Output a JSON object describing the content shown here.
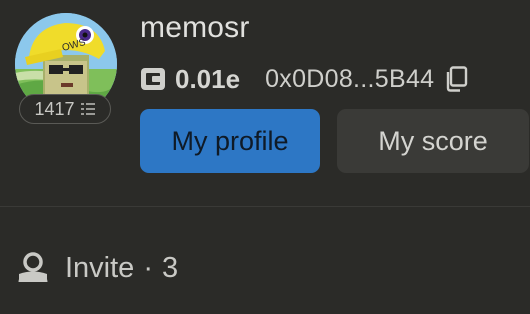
{
  "profile": {
    "username": "memosr",
    "level": "1417",
    "balance": "0.01e",
    "address": "0x0D08...5B44"
  },
  "actions": {
    "my_profile_label": "My profile",
    "my_score_label": "My score"
  },
  "invite": {
    "label": "Invite",
    "separator": "·",
    "count": "3"
  },
  "icons": {
    "level": "stack-icon",
    "wallet": "wallet-icon",
    "copy": "copy-icon",
    "invite": "person-icon"
  },
  "colors": {
    "background": "#2b2b28",
    "primary_button": "#2d77c5",
    "secondary_button": "#3a3a37"
  }
}
